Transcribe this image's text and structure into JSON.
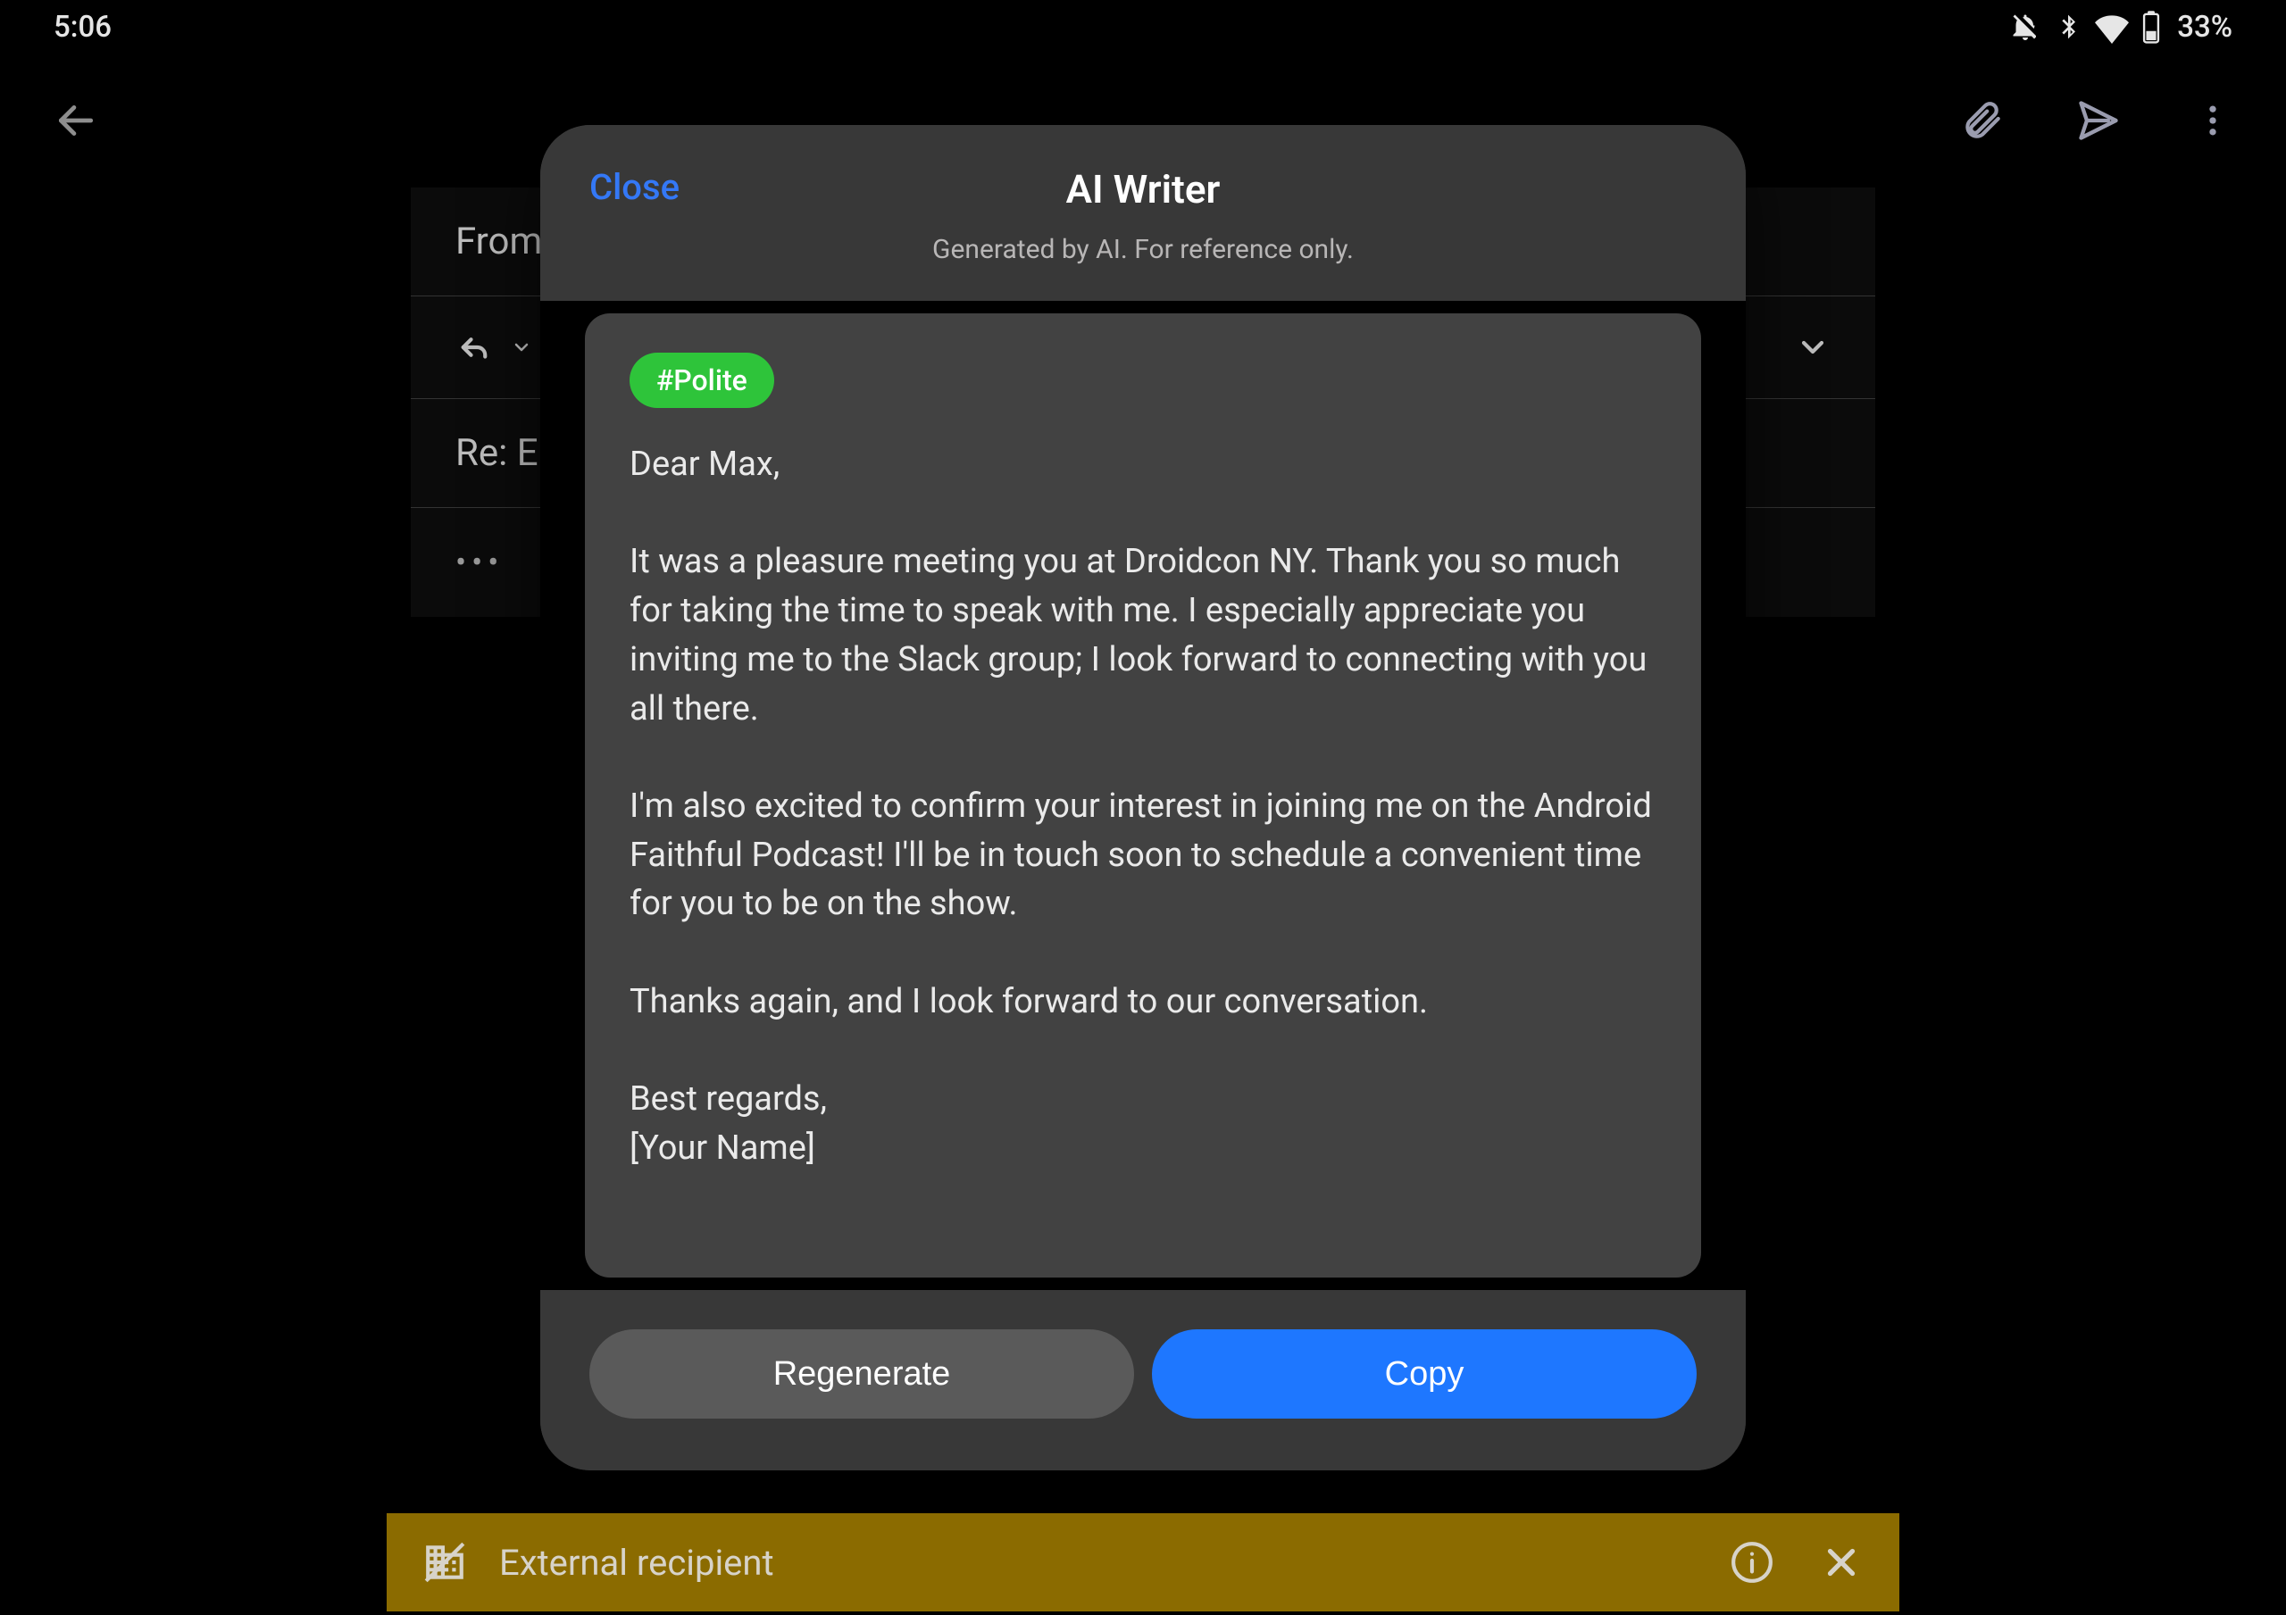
{
  "status_bar": {
    "time": "5:06",
    "battery_percent": "33%"
  },
  "compose": {
    "from_label": "From",
    "subject_text": "Re: E",
    "overflow_dots": "•••"
  },
  "modal": {
    "close_label": "Close",
    "title": "AI Writer",
    "subtitle": "Generated by AI. For reference only.",
    "tone_tag": "#Polite",
    "body_text": "Dear Max,\n\nIt was a pleasure meeting you at Droidcon NY. Thank you so much for taking the time to speak with me. I especially appreciate you inviting me to the Slack group; I look forward to connecting with you all there.\n\nI'm also excited to confirm your interest in joining me on the Android Faithful Podcast! I'll be in touch soon to schedule a convenient time for you to be on the show.\n\nThanks again, and I look forward to our conversation.\n\nBest regards,\n[Your Name]",
    "regenerate_label": "Regenerate",
    "copy_label": "Copy"
  },
  "banner": {
    "text": "External recipient"
  }
}
